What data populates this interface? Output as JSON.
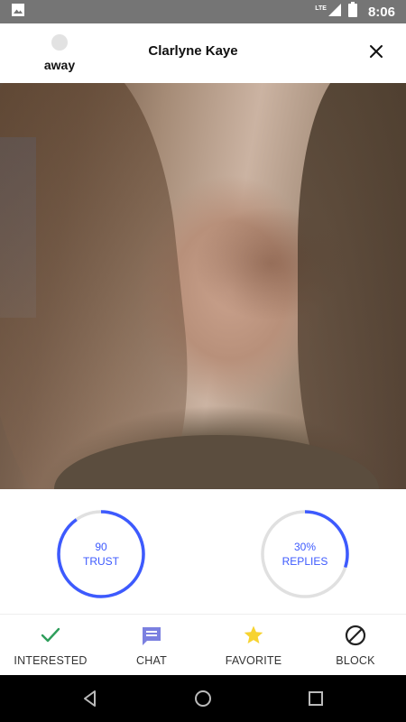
{
  "status_bar": {
    "time": "8:06",
    "network": "LTE",
    "icons": [
      "image-icon",
      "lte-signal-icon",
      "battery-icon"
    ]
  },
  "header": {
    "presence_status": "away",
    "title": "Clarlyne Kaye",
    "close_icon": "close-icon"
  },
  "stats": {
    "trust": {
      "value": "90",
      "label": "TRUST",
      "fraction": 0.9
    },
    "replies": {
      "value": "30%",
      "label": "REPLIES",
      "fraction": 0.3
    }
  },
  "actions": [
    {
      "label": "INTERESTED",
      "icon": "check-icon",
      "color": "#2e9e5b"
    },
    {
      "label": "CHAT",
      "icon": "chat-icon",
      "color": "#7b80e0"
    },
    {
      "label": "FAVORITE",
      "icon": "star-icon",
      "color": "#f7d330"
    },
    {
      "label": "BLOCK",
      "icon": "block-icon",
      "color": "#222222"
    }
  ],
  "colors": {
    "accent": "#3d5afe",
    "track": "#e0e0e0",
    "status_bar": "#757575"
  }
}
